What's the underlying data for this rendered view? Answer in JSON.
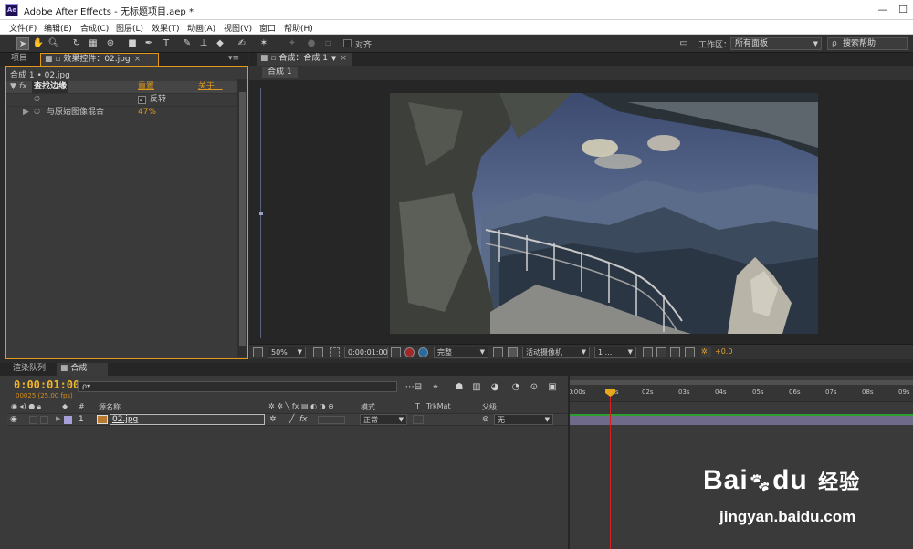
{
  "window": {
    "app_icon": "Ae",
    "title": "Adobe After Effects - 无标题项目.aep *",
    "minimize": "—",
    "restore": "☐"
  },
  "menu": [
    "文件(F)",
    "编辑(E)",
    "合成(C)",
    "图层(L)",
    "效果(T)",
    "动画(A)",
    "视图(V)",
    "窗口",
    "帮助(H)"
  ],
  "toolbar": {
    "align_label": "对齐",
    "workspace_label": "工作区：",
    "workspace_value": "所有面板",
    "search_placeholder": "搜索帮助"
  },
  "left_panel": {
    "tabs": {
      "project": "项目",
      "effect_controls": "效果控件：02.jpg"
    },
    "breadcrumb": "合成 1 • 02.jpg",
    "effect": {
      "fx": "fx",
      "name": "查找边缘",
      "reset": "重置",
      "about": "关于...",
      "invert_label": "反转",
      "blend_label": "与原始图像混合",
      "blend_value": "47%"
    }
  },
  "viewer": {
    "tab": "合成：合成 1",
    "subtab": "合成 1",
    "zoom": "50%",
    "timecode": "0:00:01:00",
    "resolution": "完整",
    "camera": "活动摄像机",
    "views": "1 ...",
    "exposure": "+0.0"
  },
  "bottom": {
    "tabs": {
      "render_queue": "渲染队列",
      "comp": "合成 1"
    },
    "timecode": "0:00:01:00",
    "fps": "00025 (25.00 fps)",
    "search_icon": "ρ▾",
    "headers": {
      "index": "#",
      "source_name": "源名称",
      "mode": "模式",
      "t": "T",
      "trkmat": "TrkMat",
      "parent": "父级"
    },
    "layer": {
      "number": "1",
      "name": "02.jpg",
      "mode": "正常",
      "parent": "无"
    },
    "ruler_ticks": [
      "0:00s",
      "01s",
      "02s",
      "03s",
      "04s",
      "05s",
      "06s",
      "07s",
      "08s",
      "09s"
    ]
  },
  "watermark": {
    "brand": "Bai",
    "paw_suffix": "du",
    "cn": "经验",
    "url": "jingyan.baidu.com"
  }
}
